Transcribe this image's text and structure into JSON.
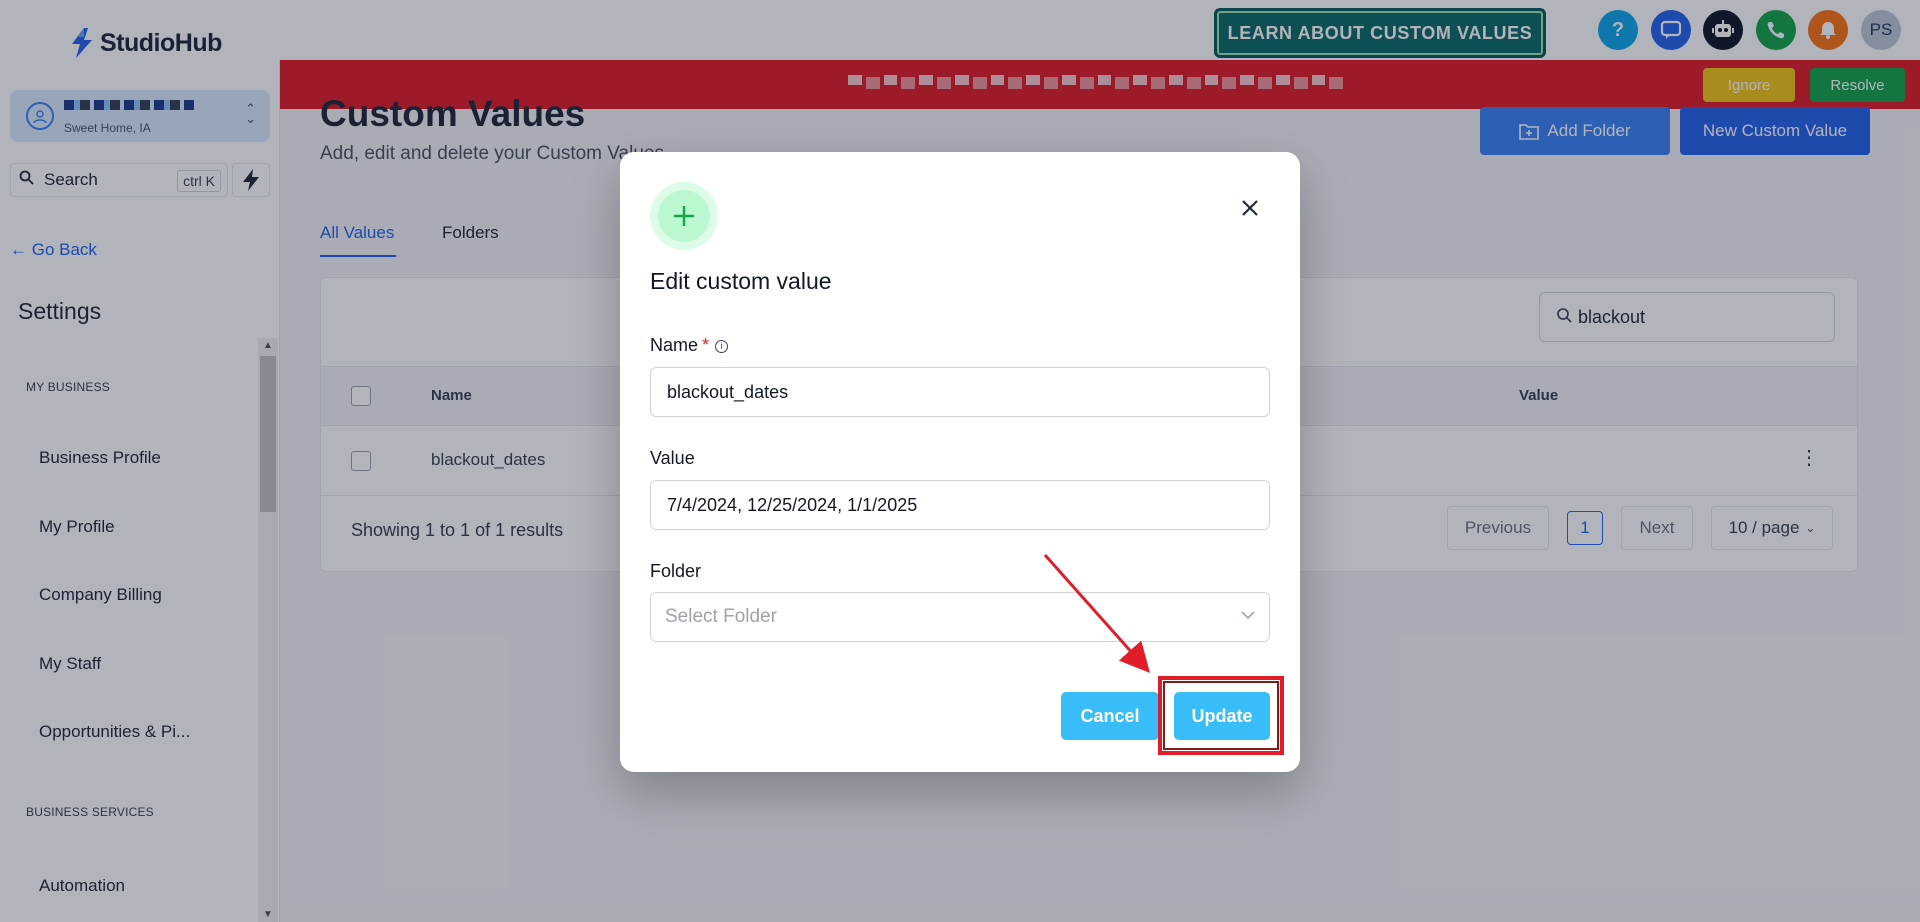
{
  "brand": {
    "name": "StudioHub"
  },
  "header": {
    "learn_button": "LEARN ABOUT CUSTOM VALUES",
    "icons": [
      "help-icon",
      "chat-icon",
      "bot-icon",
      "phone-icon",
      "bell-icon"
    ],
    "avatar_initials": "PS"
  },
  "banner": {
    "ignore_label": "Ignore",
    "resolve_label": "Resolve",
    "color": "#e11d2a"
  },
  "sidebar": {
    "location_subtitle": "Sweet Home, IA",
    "search_label": "Search",
    "search_shortcut": "ctrl K",
    "go_back": "← Go Back",
    "settings_title": "Settings",
    "sections": [
      {
        "title": "MY BUSINESS",
        "items": [
          "Business Profile",
          "My Profile",
          "Company Billing",
          "My Staff",
          "Opportunities & Pi..."
        ]
      },
      {
        "title": "BUSINESS SERVICES",
        "items": [
          "Automation"
        ]
      }
    ]
  },
  "main": {
    "title": "Custom Values",
    "subtitle": "Add, edit and delete your Custom Values",
    "add_folder_label": "Add Folder",
    "new_custom_value_label": "New Custom Value",
    "tabs": [
      {
        "label": "All Values",
        "active": true
      },
      {
        "label": "Folders",
        "active": false
      }
    ],
    "search_value": "blackout",
    "table": {
      "columns": [
        "Name",
        "Value"
      ],
      "rows": [
        {
          "name": "blackout_dates",
          "value": ""
        }
      ]
    },
    "pagination": {
      "showing": "Showing 1 to 1 of 1 results",
      "previous": "Previous",
      "current_page": "1",
      "next": "Next",
      "page_size": "10 / page"
    }
  },
  "modal": {
    "title": "Edit custom value",
    "name_label": "Name",
    "required_mark": "*",
    "name_value": "blackout_dates",
    "value_label": "Value",
    "value_value": "7/4/2024, 12/25/2024, 1/1/2025",
    "folder_label": "Folder",
    "folder_placeholder": "Select Folder",
    "cancel_label": "Cancel",
    "update_label": "Update",
    "accent_color": "#38bdf8"
  }
}
